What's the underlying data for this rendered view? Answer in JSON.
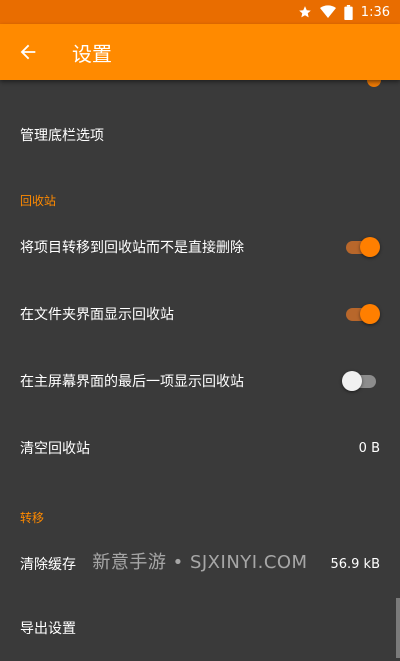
{
  "status_bar": {
    "time": "1:36",
    "icons": [
      "star-icon",
      "wifi-icon",
      "battery-icon"
    ]
  },
  "app_bar": {
    "title": "设置",
    "back_icon": "arrow-left-icon"
  },
  "items": {
    "manage_bottom_bar": "管理底栏选项",
    "recycle_section": "回收站",
    "move_to_recycle": "将项目转移到回收站而不是直接删除",
    "move_to_recycle_on": true,
    "show_in_folder": "在文件夹界面显示回收站",
    "show_in_folder_on": true,
    "show_last_home": "在主屏幕界面的最后一项显示回收站",
    "show_last_home_on": false,
    "empty_recycle": "清空回收站",
    "empty_recycle_size": "0 B",
    "transfer_section": "转移",
    "clear_cache": "清除缓存",
    "clear_cache_size": "56.9 kB",
    "export_settings": "导出设置"
  },
  "watermark": "新意手游 • SJXINYI.COM",
  "colors": {
    "accent": "#ff8a00",
    "status_bar": "#e96d00",
    "background": "#3a3a3a"
  }
}
